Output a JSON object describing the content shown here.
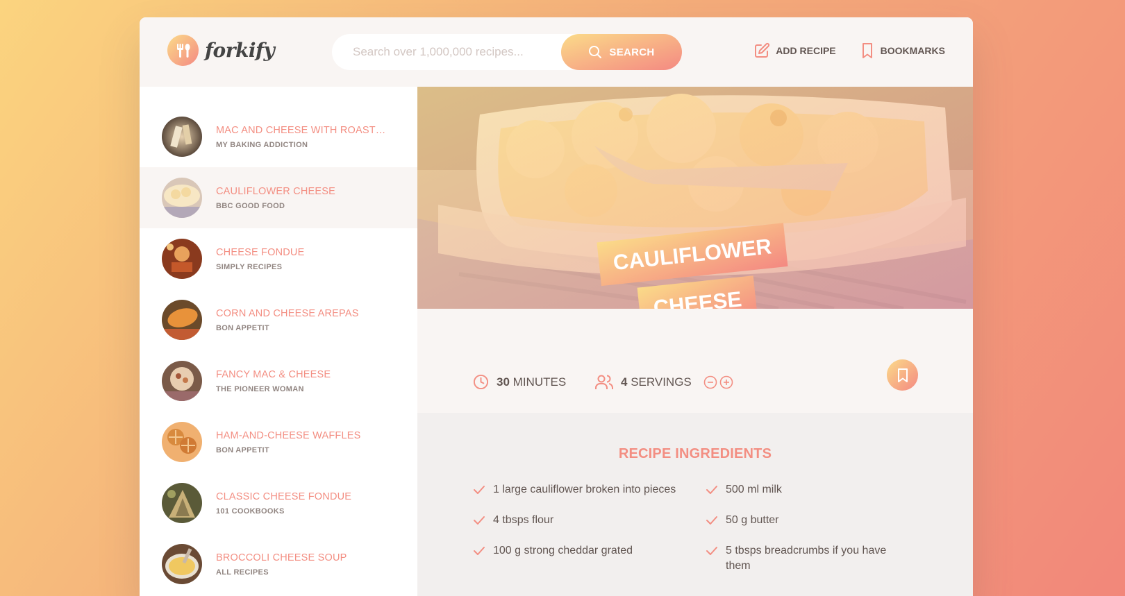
{
  "colors": {
    "accent": "#f38e82",
    "gradient_start": "#fbdb89",
    "gradient_end": "#f48982",
    "text": "#615551",
    "muted": "#918581"
  },
  "header": {
    "logo_text": "forkify",
    "search_placeholder": "Search over 1,000,000 recipes...",
    "search_button": "SEARCH",
    "add_recipe": "ADD RECIPE",
    "bookmarks": "BOOKMARKS"
  },
  "results": [
    {
      "title": "MAC AND CHEESE WITH ROASTED CHICKEN, GOAT CHEESE, AND ROSEMARY",
      "publisher": "MY BAKING ADDICTION",
      "active": false
    },
    {
      "title": "CAULIFLOWER CHEESE",
      "publisher": "BBC GOOD FOOD",
      "active": true
    },
    {
      "title": "CHEESE FONDUE",
      "publisher": "SIMPLY RECIPES",
      "active": false
    },
    {
      "title": "CORN AND CHEESE AREPAS",
      "publisher": "BON APPETIT",
      "active": false
    },
    {
      "title": "FANCY MAC & CHEESE",
      "publisher": "THE PIONEER WOMAN",
      "active": false
    },
    {
      "title": "HAM-AND-CHEESE WAFFLES",
      "publisher": "BON APPETIT",
      "active": false
    },
    {
      "title": "CLASSIC CHEESE FONDUE",
      "publisher": "101 COOKBOOKS",
      "active": false
    },
    {
      "title": "BROCCOLI CHEESE SOUP",
      "publisher": "ALL RECIPES",
      "active": false
    }
  ],
  "recipe": {
    "title_line1": "CAULIFLOWER",
    "title_line2": "CHEESE",
    "minutes": "30",
    "minutes_label": "MINUTES",
    "servings": "4",
    "servings_label": "SERVINGS",
    "ingredients_heading": "RECIPE INGREDIENTS",
    "ingredients": [
      "1 large cauliflower broken into pieces",
      "500 ml milk",
      "4 tbsps flour",
      "50 g butter",
      "100 g strong cheddar grated",
      "5 tbsps breadcrumbs if you have them"
    ]
  },
  "icons": {
    "logo": "fork-spoon-icon",
    "search": "search-icon",
    "add_recipe": "edit-icon",
    "bookmarks": "bookmark-icon",
    "minutes": "clock-icon",
    "servings": "users-icon",
    "decrease": "minus-circle-icon",
    "increase": "plus-circle-icon",
    "ingredient": "check-icon"
  }
}
